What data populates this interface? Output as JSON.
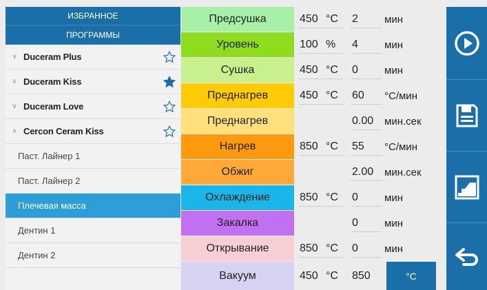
{
  "sidebar": {
    "favorites_label": "ИЗБРАННОЕ",
    "programs_label": "ПРОГРАММЫ",
    "items": [
      {
        "label": "Duceram Plus"
      },
      {
        "label": "Duceram Kiss"
      },
      {
        "label": "Duceram Love"
      },
      {
        "label": "Cercon Ceram Kiss"
      },
      {
        "label": "Паст. Лайнер 1"
      },
      {
        "label": "Паст. Лайнер 2"
      },
      {
        "label": "Плечевая масса"
      },
      {
        "label": "Дентин 1"
      },
      {
        "label": "Дентин 2"
      }
    ]
  },
  "stages": [
    {
      "label": "Предсушка",
      "color": "#a8f0a8",
      "val1": "450",
      "unit1": "°C",
      "val2": "2",
      "unit2": "мин"
    },
    {
      "label": "Уровень",
      "color": "#8edc1e",
      "val1": "100",
      "unit1": "%",
      "val2": "4",
      "unit2": "мин"
    },
    {
      "label": "Сушка",
      "color": "#c8f08c",
      "val1": "450",
      "unit1": "°C",
      "val2": "0",
      "unit2": "мин"
    },
    {
      "label": "Преднагрев",
      "color": "#ffcb05",
      "val1": "450",
      "unit1": "°C",
      "val2": "60",
      "unit2": "°C/мин"
    },
    {
      "label": "Преднагрев",
      "color": "#ffe07a",
      "val1": "",
      "unit1": "",
      "val2": "0.00",
      "unit2": "мин.сек"
    },
    {
      "label": "Нагрев",
      "color": "#ff9a10",
      "val1": "850",
      "unit1": "°C",
      "val2": "55",
      "unit2": "°C/мин"
    },
    {
      "label": "Обжиг",
      "color": "#ffa93a",
      "val1": "",
      "unit1": "",
      "val2": "2.00",
      "unit2": "мин.сек"
    },
    {
      "label": "Охлаждение",
      "color": "#1ab6ea",
      "val1": "850",
      "unit1": "°C",
      "val2": "0",
      "unit2": "мин"
    },
    {
      "label": "Закалка",
      "color": "#c070f0",
      "val1": "",
      "unit1": "",
      "val2": "0",
      "unit2": "мин"
    },
    {
      "label": "Открывание",
      "color": "#f5cfd4",
      "val1": "850",
      "unit1": "°C",
      "val2": "0",
      "unit2": "мин"
    },
    {
      "label": "Вакуум",
      "color": "#d6d3f2",
      "val1": "450",
      "unit1": "°C",
      "val2": "850",
      "unit2": "°C"
    }
  ],
  "toolbar": {
    "icons": [
      "play-icon",
      "save-icon",
      "chart-icon",
      "back-icon"
    ]
  },
  "colors": {
    "accent": "#1b6fa8",
    "selected": "#2d9ed8",
    "star_filled": "#1b6fa8"
  }
}
